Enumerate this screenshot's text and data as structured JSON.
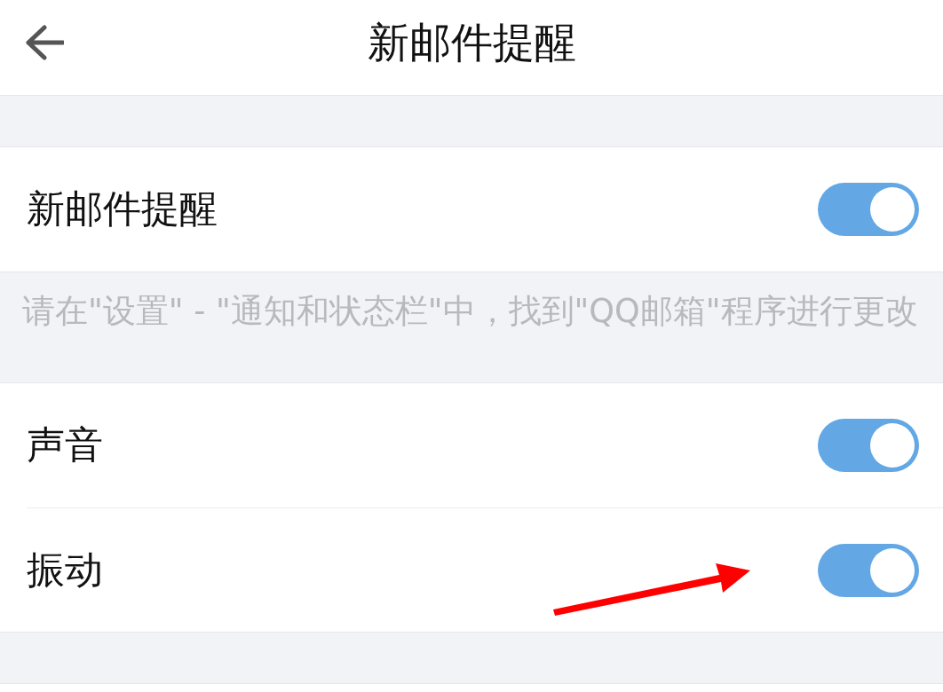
{
  "header": {
    "title": "新邮件提醒"
  },
  "sections": [
    {
      "items": [
        {
          "label": "新邮件提醒",
          "on": true
        }
      ],
      "hint": "请在\"设置\" - \"通知和状态栏\"中，找到\"QQ邮箱\"程序进行更改"
    },
    {
      "items": [
        {
          "label": "声音",
          "on": true
        },
        {
          "label": "振动",
          "on": true
        }
      ]
    }
  ]
}
